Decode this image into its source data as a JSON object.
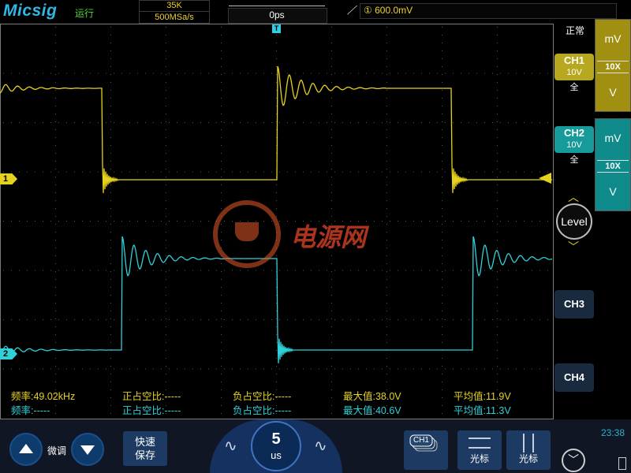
{
  "header": {
    "brand": "Micsig",
    "run_status": "运行",
    "memory_depth": "35K",
    "sample_rate": "500MSa/s",
    "trigger_position": "0ps",
    "trigger_source_mark": "①",
    "trigger_level": "600.0mV"
  },
  "channels": {
    "ch1": {
      "label": "CH1",
      "scale": "10V",
      "bandwidth": "全",
      "marker": "1",
      "color": "#e6d21e"
    },
    "ch2": {
      "label": "CH2",
      "scale": "10V",
      "bandwidth": "全",
      "marker": "2",
      "color": "#2fd0d8"
    },
    "ch3": {
      "label": "CH3"
    },
    "ch4": {
      "label": "CH4"
    }
  },
  "right_panel": {
    "mode": "正常",
    "ch1_scale": {
      "top_unit": "mV",
      "multiplier": "10X",
      "bottom_unit": "V"
    },
    "ch2_scale": {
      "top_unit": "mV",
      "multiplier": "10X",
      "bottom_unit": "V"
    },
    "level_label": "Level",
    "level_up": "︿",
    "level_down": "﹀"
  },
  "watermark": {
    "text": "电源网"
  },
  "measurements": {
    "row1": {
      "frequency": "频率:49.02kHz",
      "pos_duty": "正占空比:-----",
      "neg_duty": "负占空比:-----",
      "max": "最大值:38.0V",
      "mean": "平均值:11.9V"
    },
    "row2": {
      "frequency": "频率:-----",
      "pos_duty": "正占空比:-----",
      "neg_duty": "负占空比:-----",
      "max": "最大值:40.6V",
      "mean": "平均值:11.3V"
    }
  },
  "bottom": {
    "fine_label": "微调",
    "quick_save_line1": "快速",
    "quick_save_line2": "保存",
    "timebase_value": "5",
    "timebase_unit": "us",
    "ch_select_label": "CH1",
    "cursor_h_label": "光标",
    "cursor_v_label": "光标",
    "clock": "23:38"
  },
  "icons": [
    "wave-left-icon",
    "wave-right-icon",
    "up-arrow-icon",
    "down-arrow-icon",
    "battery-icon",
    "menu-chevron-icon",
    "trigger-slope-icon"
  ]
}
